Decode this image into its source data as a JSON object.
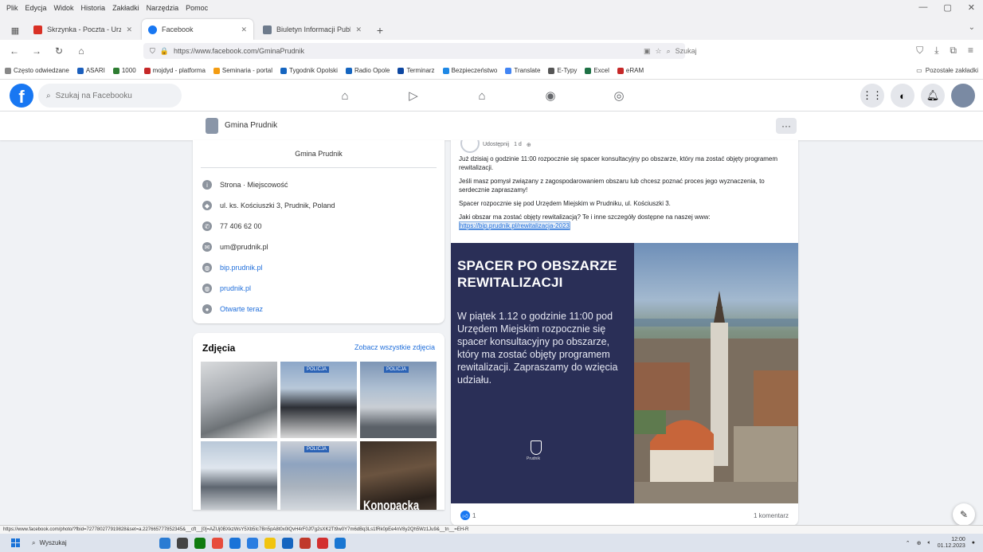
{
  "browser": {
    "menu": [
      "Plik",
      "Edycja",
      "Widok",
      "Historia",
      "Zakładki",
      "Narzędzia",
      "Pomoc"
    ],
    "window_controls": [
      "—",
      "▢",
      "✕"
    ],
    "tabs": [
      {
        "label": "Skrzynka - Poczta - Urząd - ...",
        "active": false,
        "color": "#d93025"
      },
      {
        "label": "Facebook",
        "active": true,
        "color": "#1877f2"
      },
      {
        "label": "Biuletyn Informacji Publicznej",
        "active": false,
        "color": "#6e7b8c"
      }
    ],
    "new_tab": "+",
    "url": "https://www.facebook.com/GminaPrudnik",
    "search_placeholder": "Szukaj",
    "bookmarks": [
      {
        "label": "Często odwiedzane",
        "color": "#888888"
      },
      {
        "label": "ASARI",
        "color": "#1b5fbd"
      },
      {
        "label": "1000",
        "color": "#2e7d32"
      },
      {
        "label": "mojdyd - platforma",
        "color": "#c62828"
      },
      {
        "label": "Seminaria - portal",
        "color": "#f39c12"
      },
      {
        "label": "Tygodnik Opolski",
        "color": "#1565c0"
      },
      {
        "label": "Radio Opole",
        "color": "#1565c0"
      },
      {
        "label": "Terminarz",
        "color": "#0d47a1"
      },
      {
        "label": "Bezpieczeństwo",
        "color": "#1e88e5"
      },
      {
        "label": "Translate",
        "color": "#4285f4"
      },
      {
        "label": "E-Typy",
        "color": "#555555"
      },
      {
        "label": "Excel",
        "color": "#1e7145"
      },
      {
        "label": "eRAM",
        "color": "#c62828"
      }
    ],
    "other_bookmarks": "Pozostałe zakładki"
  },
  "facebook": {
    "logo": "f",
    "search_placeholder": "Szukaj na Facebooku"
  },
  "page": {
    "name": "Gmina Prudnik",
    "more": "···",
    "intro": {
      "top_name": "Gmina Prudnik",
      "rows": [
        {
          "icon": "i",
          "text": "Strona · Miejscowość",
          "link": false
        },
        {
          "icon": "◆",
          "text": "ul. ks. Kościuszki 3, Prudnik, Poland",
          "link": false
        },
        {
          "icon": "✆",
          "text": "77 406 62 00",
          "link": false
        },
        {
          "icon": "✉",
          "text": "um@prudnik.pl",
          "link": false
        },
        {
          "icon": "◍",
          "text": "bip.prudnik.pl",
          "link": true
        },
        {
          "icon": "◍",
          "text": "prudnik.pl",
          "link": true
        },
        {
          "icon": "●",
          "text": "Otwarte teraz",
          "link": true
        }
      ]
    },
    "photos": {
      "title": "Zdjęcia",
      "see_all": "Zobacz wszystkie zdjęcia",
      "items": [
        {
          "tag": ""
        },
        {
          "tag": "POLICJA"
        },
        {
          "tag": "POLICJA"
        },
        {
          "tag": ""
        },
        {
          "tag": "POLICJA"
        },
        {
          "tag": "",
          "caption": "Konopacka"
        }
      ]
    }
  },
  "post": {
    "meta_time": "1 d",
    "meta_label": "Udostępnij",
    "paragraphs": [
      "Już dzisiaj o godzinie 11:00 rozpocznie się spacer konsultacyjny po obszarze, który ma zostać objęty programem rewitalizacji.",
      "Jeśli masz pomysł związany z zagospodarowaniem obszaru lub chcesz poznać proces jego wyznaczenia, to serdecznie zapraszamy!",
      "Spacer rozpocznie się pod Urzędem Miejskim w Prudniku, ul. Kościuszki 3."
    ],
    "last_para": "Jaki obszar ma zostać objęty rewitalizacją? Te i inne szczegóły dostępne na naszej www:",
    "link": "https://bip.prudnik.pl/rewitalizacja-2023",
    "banner": {
      "title": "SPACER PO OBSZARZE REWITALIZACJI",
      "body": "W piątek 1.12 o godzinie 11:00 pod Urzędem Miejskim rozpocznie się spacer konsultacyjny po obszarze, który ma zostać objęty programem rewitalizacji. Zapraszamy do wzięcia udziału.",
      "crest_label": "Prudnik"
    },
    "likes": "1",
    "comments": "1 komentarz"
  },
  "status_url": "https://www.facebook.com/photo/?fbid=727780277919828&set=a.227665777852345&__cft__[0]=AZUj0BXkzWsY5Xb5Ic7Bn5pA8t0x0lQvH4rF0Jf7g2sXK2Tt9w0Y7m6dBq3Ls1fRk0pEe4nV8y2Qh5Wz1Ju9&__tn__=EH-R",
  "taskbar": {
    "search": "Wyszukaj",
    "apps": [
      "#2b7cd3",
      "#444444",
      "#0f7b0f",
      "#e74c3c",
      "#1a73d8",
      "#2a7de1",
      "#f1c40f",
      "#1565c0",
      "#c0392b",
      "#d32f2f",
      "#1976d2"
    ],
    "time": "12:00",
    "date": "01.12.2023"
  }
}
